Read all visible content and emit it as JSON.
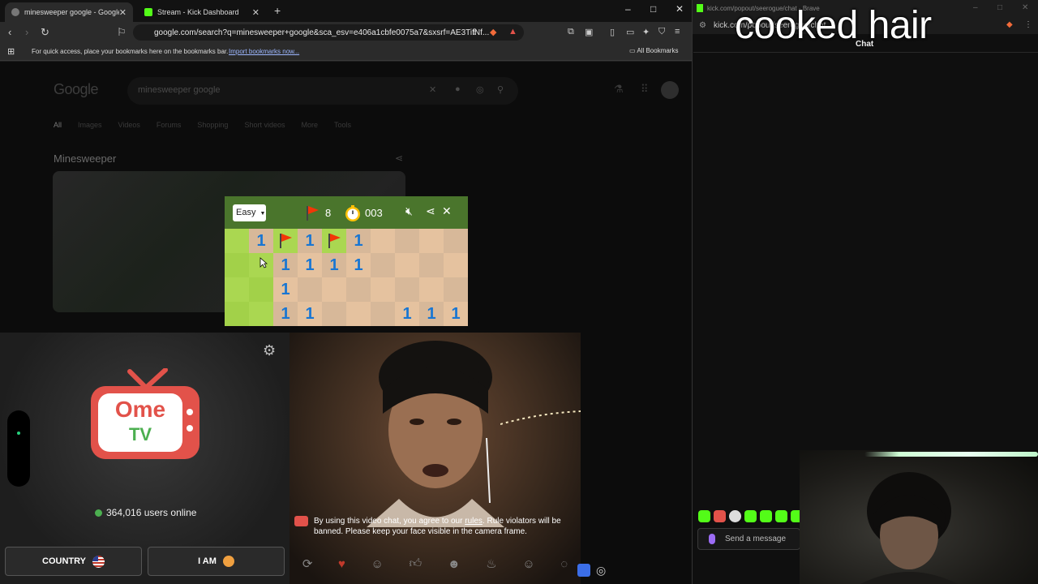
{
  "browser": {
    "tabs": [
      {
        "title": "minesweeper google - Google S",
        "active": true
      },
      {
        "title": "Stream - Kick Dashboard",
        "active": false
      }
    ],
    "new_tab": "+",
    "url": "google.com/search?q=minesweeper+google&sca_esv=e406a1cbfe0075a7&sxsrf=AE3TifNf...",
    "bookmark_hint": "For quick access, place your bookmarks here on the bookmarks bar.",
    "import_link": "Import bookmarks now...",
    "all_bookmarks": "All Bookmarks"
  },
  "google": {
    "logo": "Google",
    "query": "minesweeper google",
    "tabs": [
      "All",
      "Images",
      "Videos",
      "Forums",
      "Shopping",
      "Short videos",
      "More",
      "Tools"
    ],
    "result_title": "Minesweeper"
  },
  "minesweeper": {
    "difficulty": "Easy",
    "flags_left": "8",
    "timer": "003",
    "board": [
      [
        "",
        "1",
        "F",
        "1",
        "F",
        "1",
        "",
        "",
        "",
        ""
      ],
      [
        "",
        "",
        "1",
        "1",
        "1",
        "1",
        "",
        "",
        "",
        ""
      ],
      [
        "",
        "",
        "1",
        "",
        "",
        "",
        "",
        "",
        "",
        ""
      ],
      [
        "",
        "",
        "1",
        "1",
        "",
        "",
        "",
        "1",
        "1",
        "1"
      ]
    ],
    "revealed": [
      [
        false,
        true,
        false,
        true,
        false,
        true,
        true,
        true,
        true,
        true
      ],
      [
        false,
        false,
        true,
        true,
        true,
        true,
        true,
        true,
        true,
        true
      ],
      [
        false,
        false,
        true,
        true,
        true,
        true,
        true,
        true,
        true,
        true
      ],
      [
        false,
        false,
        true,
        true,
        true,
        true,
        true,
        true,
        true,
        true
      ]
    ]
  },
  "ometv": {
    "logo_top": "Ome",
    "logo_bottom": "TV",
    "users_online": "364,016 users online",
    "country_label": "COUNTRY",
    "iam_label": "I AM",
    "disclaimer_pre": "By using this video chat, you agree to our ",
    "disclaimer_link": "rules",
    "disclaimer_post": ". Rule violators will be banned. Please keep your face visible in the camera frame."
  },
  "chat_window": {
    "title": "kick.com/popout/seerogue/chat - Brave",
    "url": "kick.com/popout/seerogue/chat",
    "overlay_text": "cooked hair",
    "chat_label": "Chat",
    "send_placeholder": "Send a message"
  },
  "colors": {
    "grass_light": "#aad751",
    "grass_dark": "#a2d149",
    "sand_light": "#e5c29f",
    "sand_dark": "#d7b899",
    "number_one": "#1976d2",
    "header_green": "#4a752c",
    "kick_green": "#53fc18",
    "ome_red": "#e2524a"
  }
}
